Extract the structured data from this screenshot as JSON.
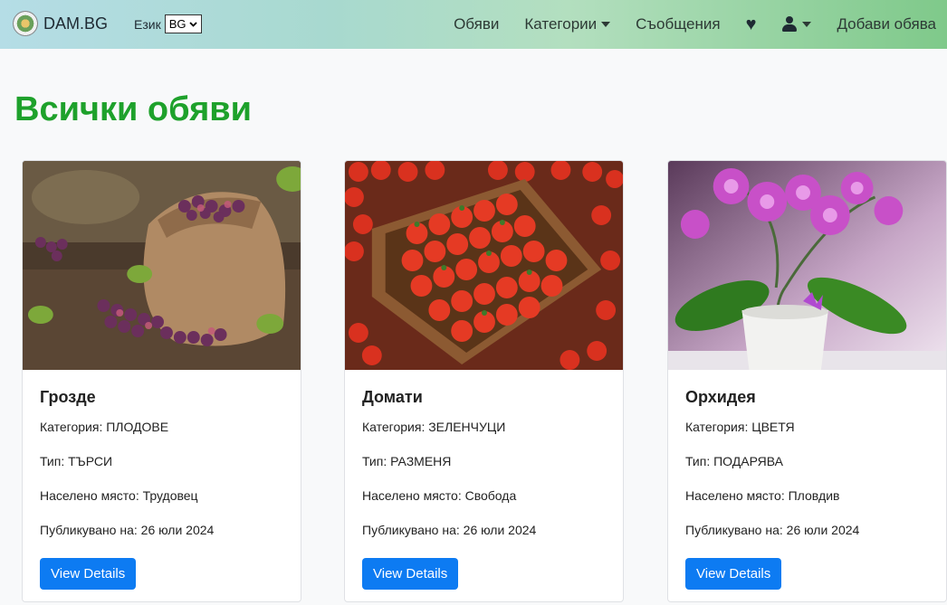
{
  "header": {
    "brand": "DAM.BG",
    "lang_label": "Език",
    "lang_value": "BG",
    "nav": {
      "ads": "Обяви",
      "categories": "Категории",
      "messages": "Съобщения",
      "add_ad": "Добави обява"
    }
  },
  "page": {
    "title": "Всички обяви"
  },
  "cards": [
    {
      "title": "Грозде",
      "category": "Категория: ПЛОДОВЕ",
      "type": "Тип: ТЪРСИ",
      "place": "Населено място: Трудовец",
      "published": "Публикувано на: 26 юли 2024",
      "button": "View Details"
    },
    {
      "title": "Домати",
      "category": "Категория: ЗЕЛЕНЧУЦИ",
      "type": "Тип: РАЗМЕНЯ",
      "place": "Населено място: Свобода",
      "published": "Публикувано на: 26 юли 2024",
      "button": "View Details"
    },
    {
      "title": "Орхидея",
      "category": "Категория: ЦВЕТЯ",
      "type": "Тип: ПОДАРЯВА",
      "place": "Населено място: Пловдив",
      "published": "Публикувано на: 26 юли 2024",
      "button": "View Details"
    }
  ]
}
